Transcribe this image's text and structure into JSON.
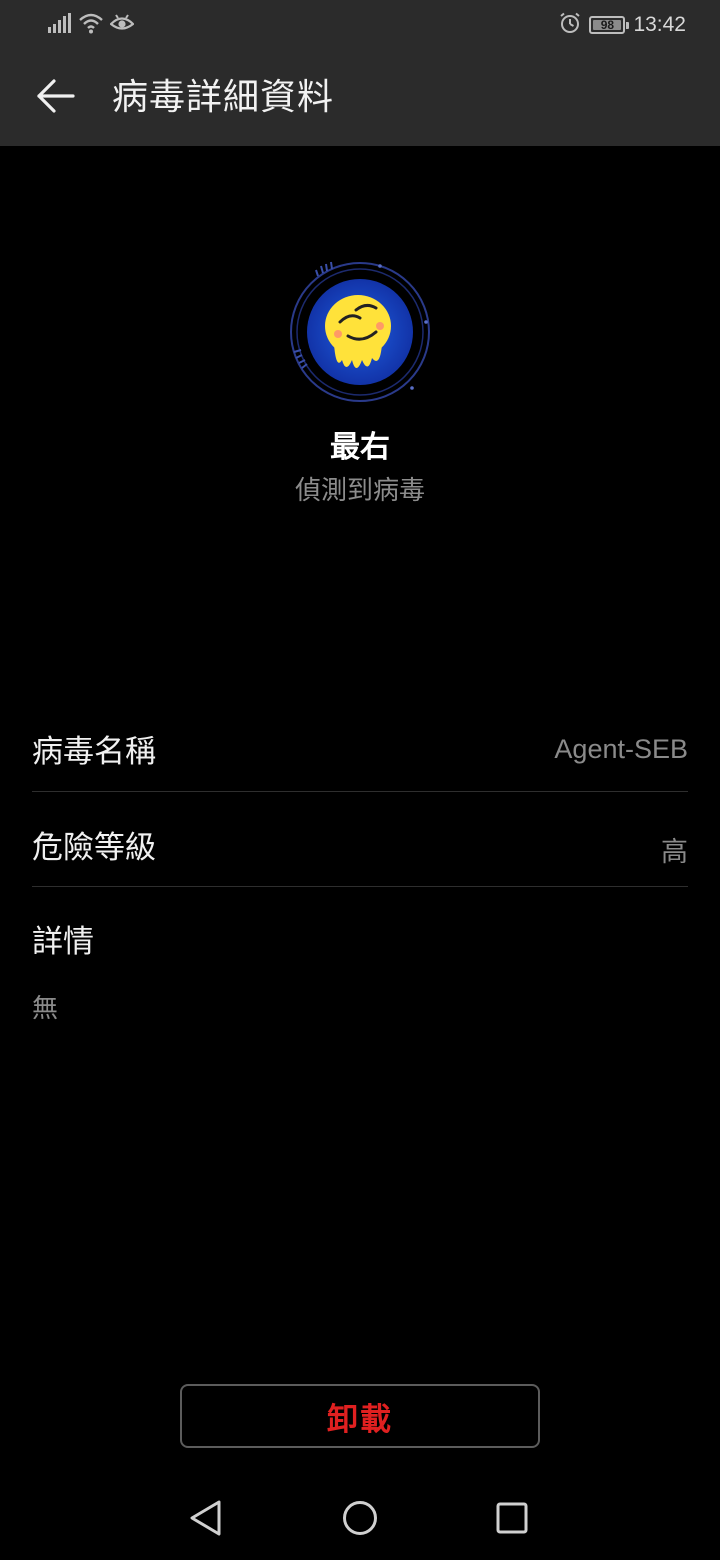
{
  "status_bar": {
    "time": "13:42",
    "battery_level": "98",
    "battery_fraction": 0.98,
    "icons": [
      "signal-icon",
      "wifi-icon",
      "eye-icon",
      "alarm-icon",
      "battery-icon"
    ]
  },
  "app_bar": {
    "title": "病毒詳細資料",
    "back_icon": "back-arrow-icon"
  },
  "app": {
    "name": "最右",
    "status": "偵測到病毒",
    "icon": "app-icon-mascot"
  },
  "info": {
    "virus_name_label": "病毒名稱",
    "virus_name_value": "Agent-SEB",
    "risk_level_label": "危險等級",
    "risk_level_value": "高",
    "details_label": "詳情",
    "details_value": "無"
  },
  "actions": {
    "uninstall_label": "卸載"
  },
  "colors": {
    "background": "#000000",
    "bar": "#2b2b2b",
    "danger": "#e02020",
    "secondary_text": "#8a8a8a"
  },
  "nav": {
    "icons": [
      "nav-back-icon",
      "nav-home-icon",
      "nav-recents-icon"
    ]
  }
}
